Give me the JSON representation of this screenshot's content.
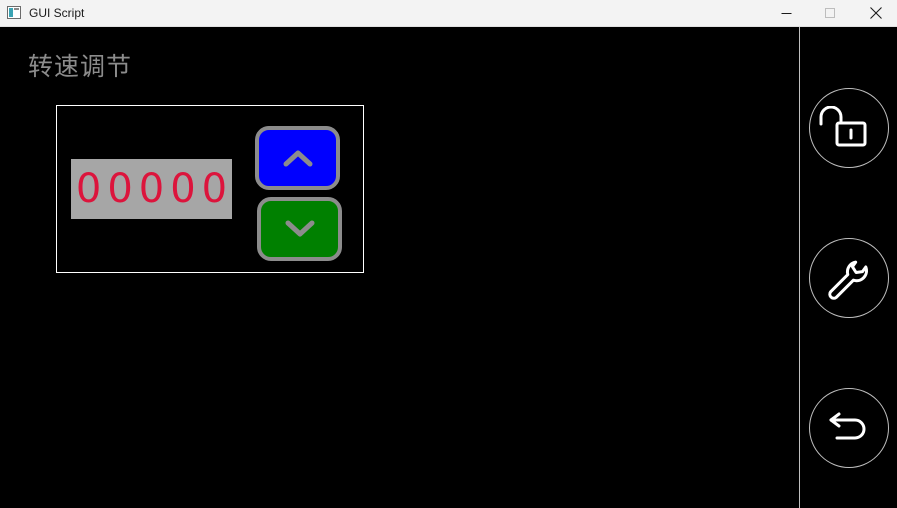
{
  "window": {
    "title": "GUI Script",
    "controls": {
      "minimize_icon": "minimize-icon",
      "maximize_icon": "maximize-icon",
      "close_icon": "close-icon"
    }
  },
  "page": {
    "title": "转速调节"
  },
  "speed_control": {
    "display_value": "00000",
    "display_color": "#dc143c",
    "display_background": "#a6a6a6",
    "up_button": {
      "icon": "chevron-up-icon",
      "color": "#0000ff"
    },
    "down_button": {
      "icon": "chevron-down-icon",
      "color": "#008000"
    }
  },
  "sidebar": {
    "items": [
      {
        "icon": "unlock-icon"
      },
      {
        "icon": "wrench-icon"
      },
      {
        "icon": "back-arrow-icon"
      }
    ]
  }
}
